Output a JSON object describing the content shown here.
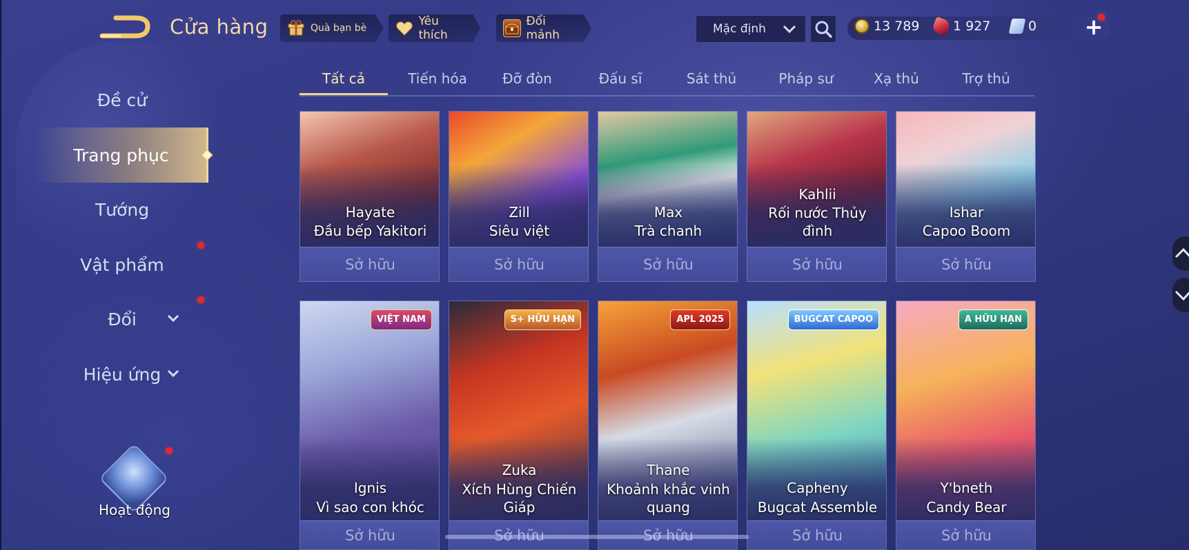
{
  "header": {
    "title": "Cửa hàng",
    "friend_gift": "Quà bạn bè",
    "favorites": "Yêu thích",
    "shard_exchange": "Đổi mảnh",
    "sort_value": "Mặc định",
    "currency": {
      "gold": "13 789",
      "ruby": "1 927",
      "ticket": "0"
    }
  },
  "sidebar": {
    "items": [
      {
        "label": "Đề cử"
      },
      {
        "label": "Trang phục"
      },
      {
        "label": "Tướng"
      },
      {
        "label": "Vật phẩm"
      },
      {
        "label": "Đổi"
      },
      {
        "label": "Hiệu ứng"
      }
    ],
    "activity": "Hoạt động"
  },
  "tabs": [
    "Tất cả",
    "Tiến hóa",
    "Đỡ đòn",
    "Đấu sĩ",
    "Sát thủ",
    "Pháp sư",
    "Xạ thủ",
    "Trợ thủ"
  ],
  "cards_row1": [
    {
      "hero": "Hayate",
      "skin": "Đầu bếp Yakitori",
      "status": "Sở hữu"
    },
    {
      "hero": "Zill",
      "skin": "Siêu việt",
      "status": "Sở hữu"
    },
    {
      "hero": "Max",
      "skin": "Trà chanh",
      "status": "Sở hữu"
    },
    {
      "hero": "Kahlii",
      "skin": "Rối nước Thủy đình",
      "status": "Sở hữu"
    },
    {
      "hero": "Ishar",
      "skin": "Capoo Boom",
      "status": "Sở hữu"
    }
  ],
  "cards_row2": [
    {
      "hero": "Ignis",
      "skin": "Vì sao con khóc",
      "badge": "VIỆT NAM",
      "status": "Sở hữu"
    },
    {
      "hero": "Zuka",
      "skin": "Xích Hùng Chiến Giáp",
      "badge": "S+ HỮU HẠN",
      "status": "Sở hữu"
    },
    {
      "hero": "Thane",
      "skin": "Khoảnh khắc vinh quang",
      "badge": "APL 2025",
      "status": "Sở hữu"
    },
    {
      "hero": "Capheny",
      "skin": "Bugcat Assemble",
      "badge": "BUGCAT CAPOO",
      "status": "Sở hữu"
    },
    {
      "hero": "Y'bneth",
      "skin": "Candy Bear",
      "badge": "A HỮU HẠN",
      "status": "Sở hữu"
    }
  ],
  "colors": {
    "accent_gold": "#f1d48f",
    "background": "#333a86",
    "notification": "#e32a2a"
  }
}
